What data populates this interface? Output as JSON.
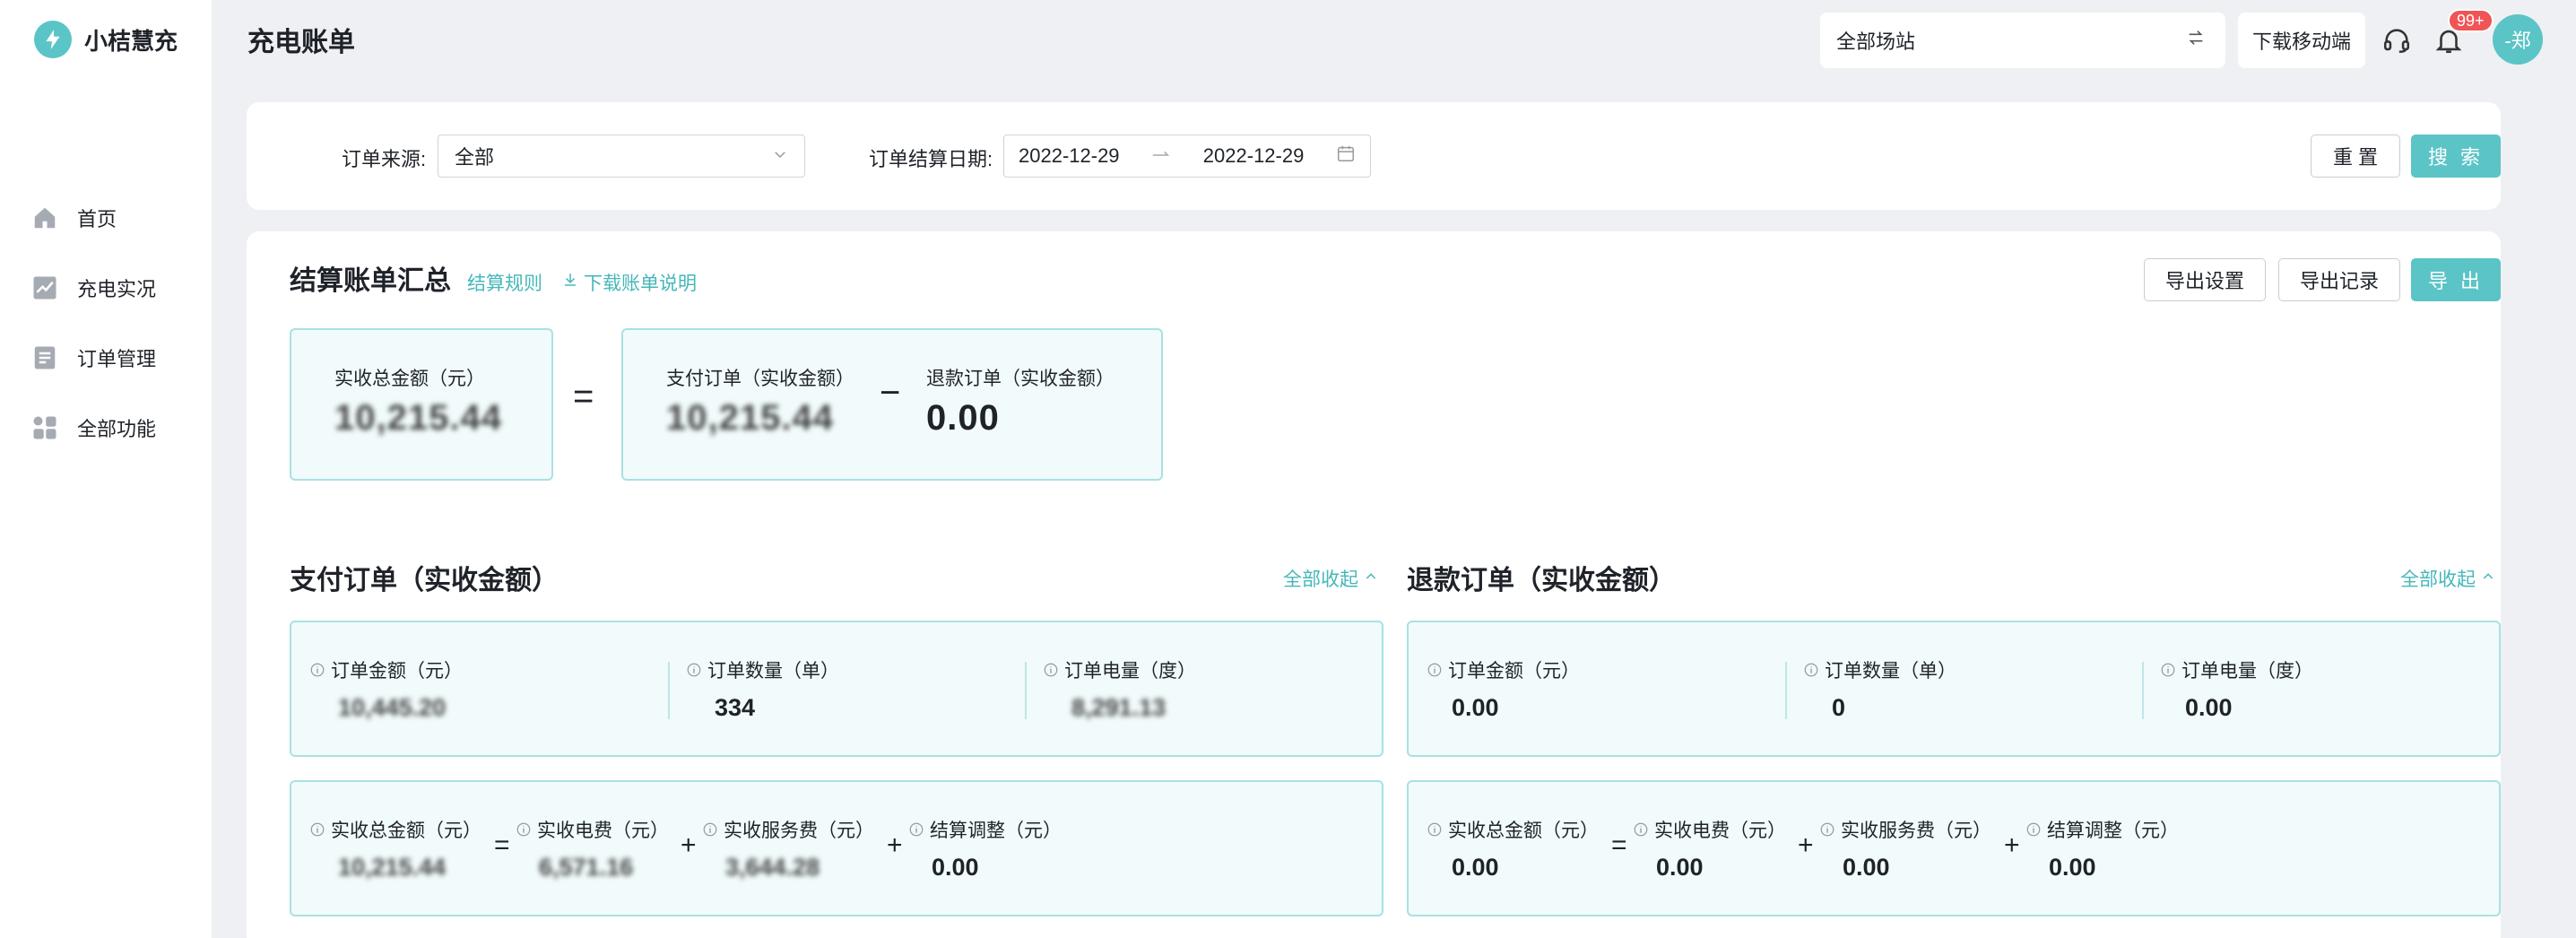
{
  "brand": {
    "name": "小桔慧充",
    "accent": "#5bc4c6"
  },
  "sidebar": {
    "items": [
      {
        "label": "首页",
        "icon": "home-icon"
      },
      {
        "label": "充电实况",
        "icon": "chart-icon"
      },
      {
        "label": "订单管理",
        "icon": "document-icon"
      },
      {
        "label": "全部功能",
        "icon": "apps-icon"
      }
    ]
  },
  "header": {
    "title": "充电账单",
    "site_select": "全部场站",
    "download_mobile": "下载移动端",
    "notification_badge": "99+",
    "avatar_text": "-郑"
  },
  "filters": {
    "source_label": "订单来源:",
    "source_value": "全部",
    "date_label": "订单结算日期:",
    "date_start": "2022-12-29",
    "date_end": "2022-12-29",
    "reset_label": "重 置",
    "search_label": "搜 索"
  },
  "summary": {
    "title": "结算账单汇总",
    "rule_link": "结算规则",
    "download_link": "下载账单说明",
    "export_settings": "导出设置",
    "export_records": "导出记录",
    "export": "导 出",
    "total_label": "实收总金额（元）",
    "total_value": "10,215.44",
    "equals": "=",
    "pay_label": "支付订单（实收金额）",
    "pay_value": "10,215.44",
    "minus": "−",
    "refund_label": "退款订单（实收金额）",
    "refund_value": "0.00"
  },
  "pay_section": {
    "title": "支付订单（实收金额）",
    "collapse": "全部收起",
    "order_amount_label": "订单金额（元）",
    "order_amount_value": "10,445.20",
    "order_count_label": "订单数量（单）",
    "order_count_value": "334",
    "order_power_label": "订单电量（度）",
    "order_power_value": "8,291.13",
    "total_label": "实收总金额（元）",
    "total_value": "10,215.44",
    "elec_label": "实收电费（元）",
    "elec_value": "6,571.16",
    "service_label": "实收服务费（元）",
    "service_value": "3,644.28",
    "adjust_label": "结算调整（元）",
    "adjust_value": "0.00"
  },
  "refund_section": {
    "title": "退款订单（实收金额）",
    "collapse": "全部收起",
    "order_amount_label": "订单金额（元）",
    "order_amount_value": "0.00",
    "order_count_label": "订单数量（单）",
    "order_count_value": "0",
    "order_power_label": "订单电量（度）",
    "order_power_value": "0.00",
    "total_label": "实收总金额（元）",
    "total_value": "0.00",
    "elec_label": "实收电费（元）",
    "elec_value": "0.00",
    "service_label": "实收服务费（元）",
    "service_value": "0.00",
    "adjust_label": "结算调整（元）",
    "adjust_value": "0.00"
  },
  "operators": {
    "eq": "=",
    "plus": "+"
  }
}
